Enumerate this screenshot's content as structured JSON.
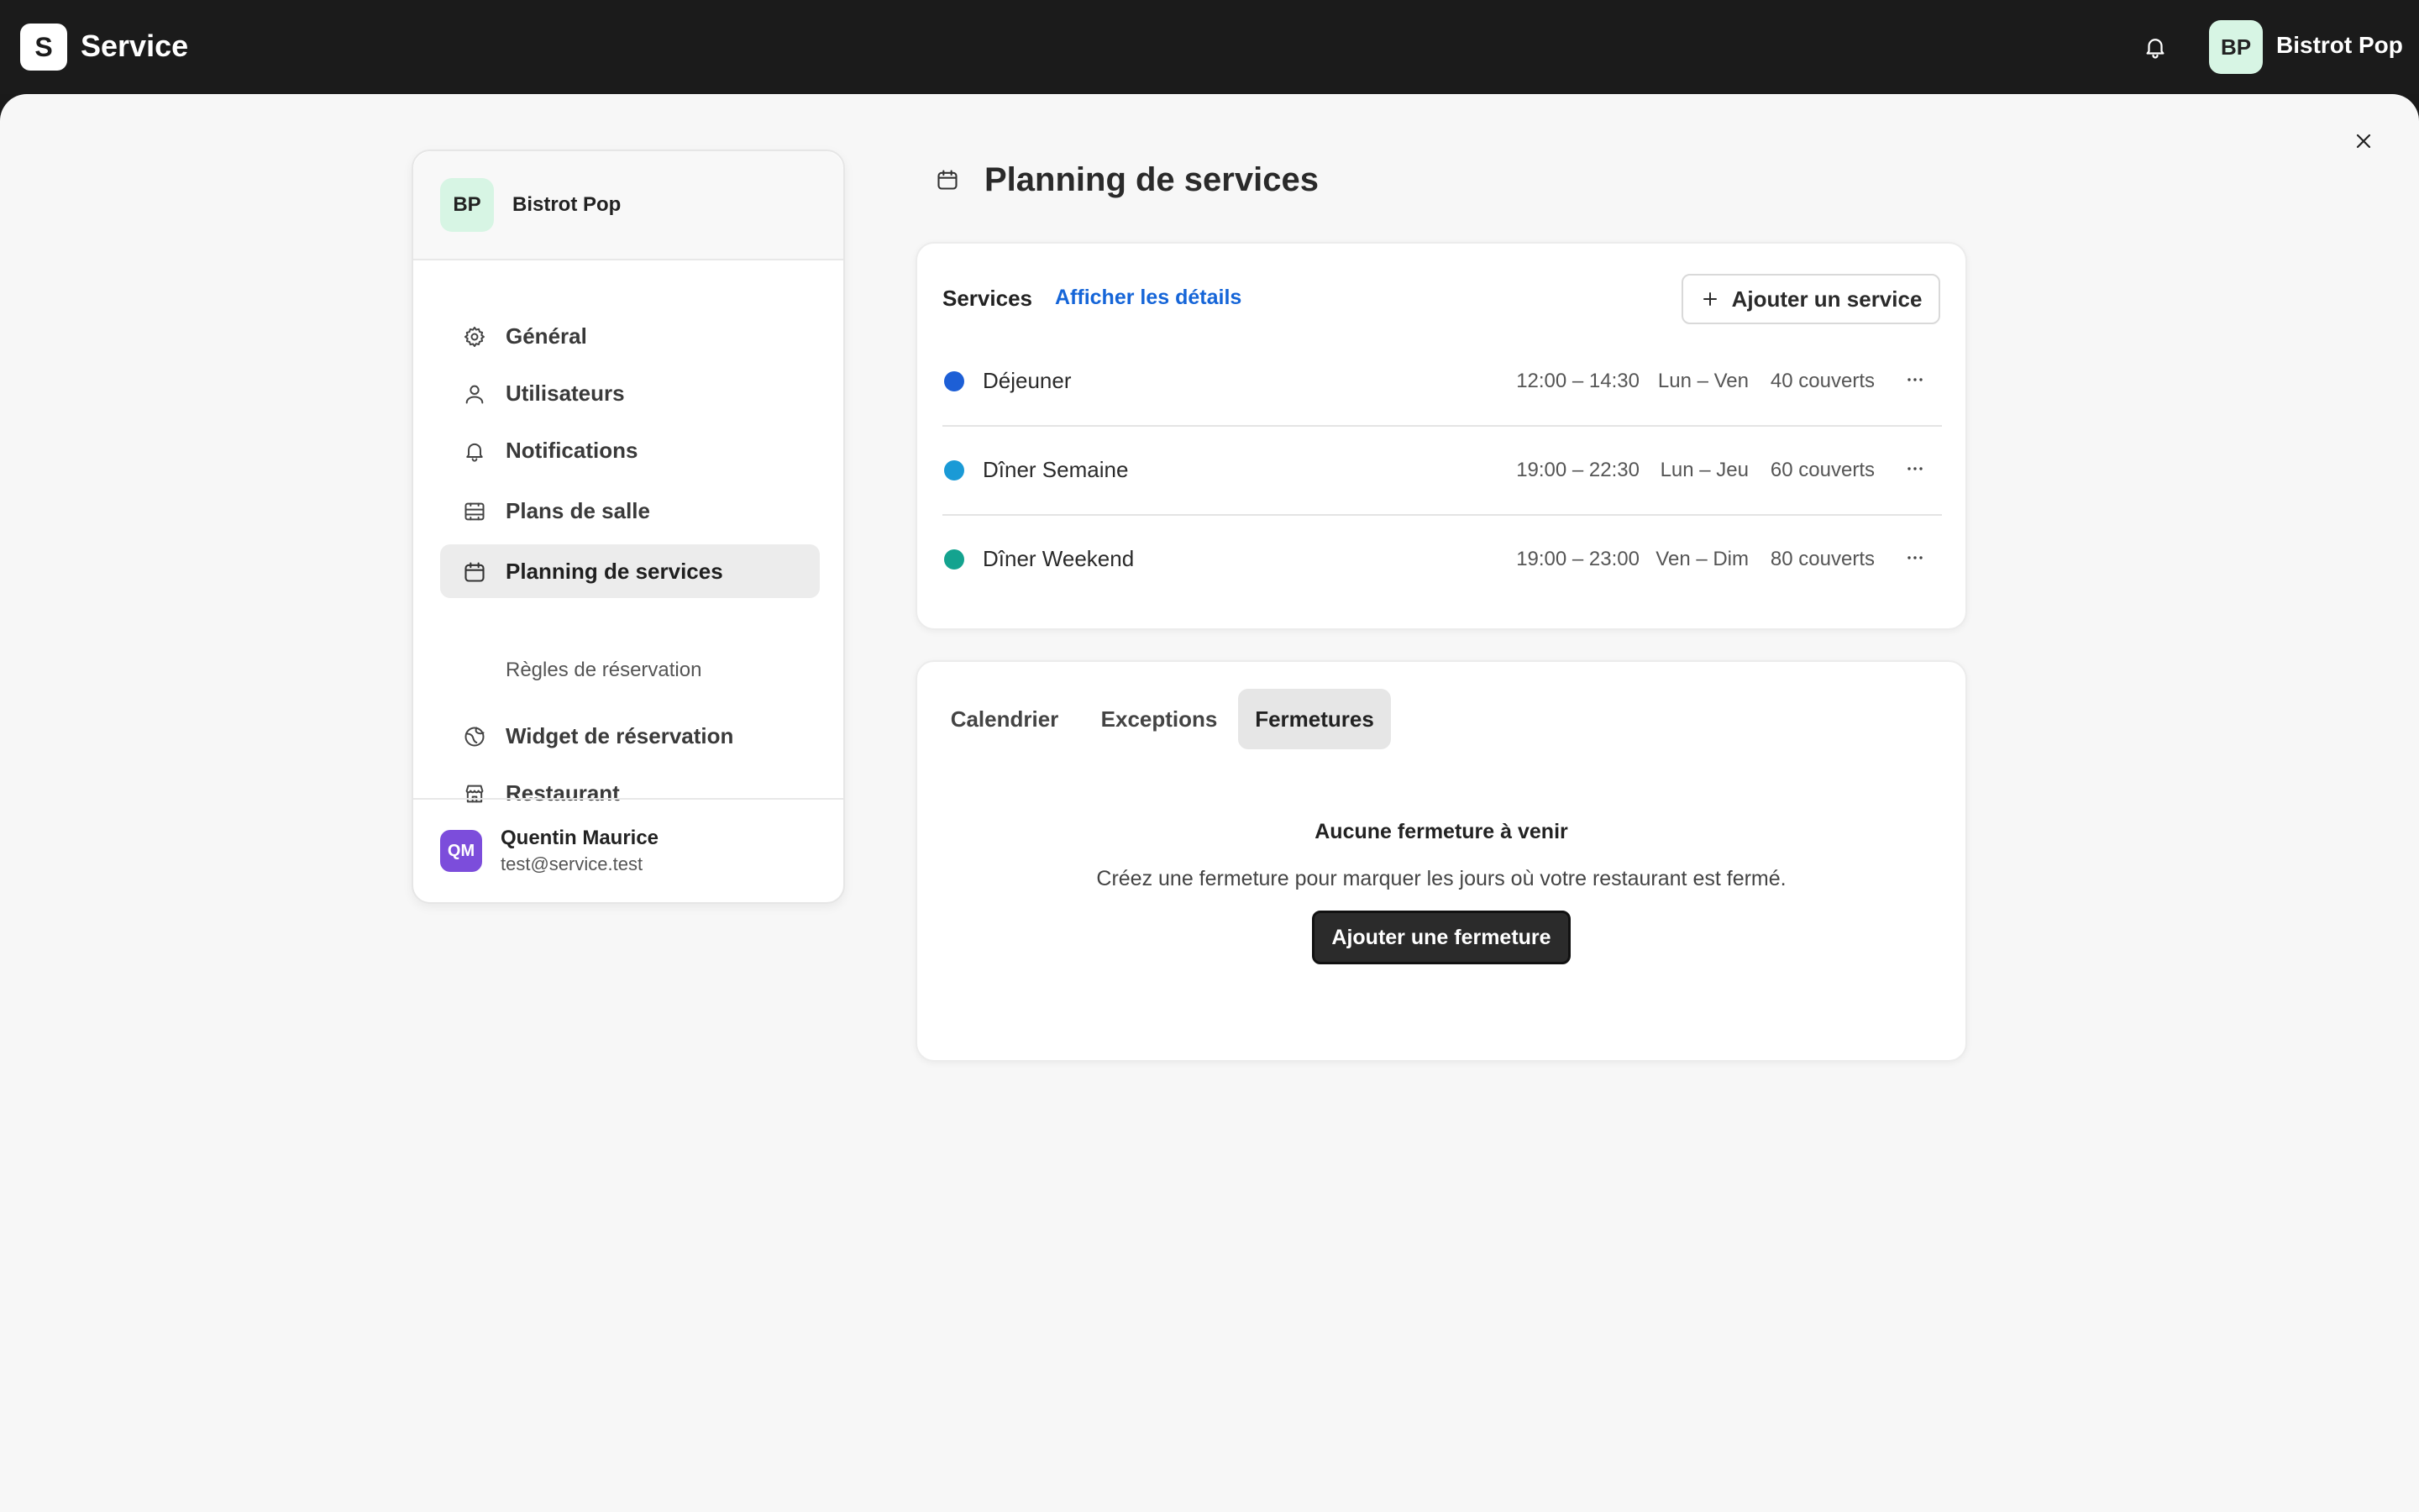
{
  "app": {
    "logo_letter": "S",
    "name": "Service"
  },
  "account": {
    "initials": "BP",
    "name": "Bistrot Pop"
  },
  "sidebar": {
    "org_initials": "BP",
    "org_name": "Bistrot Pop",
    "items": [
      {
        "label": "Général",
        "icon": "gear-icon"
      },
      {
        "label": "Utilisateurs",
        "icon": "user-icon"
      },
      {
        "label": "Notifications",
        "icon": "bell-icon"
      },
      {
        "label": "Plans de salle",
        "icon": "floor-plan-icon"
      },
      {
        "label": "Planning de services",
        "icon": "calendar-icon",
        "active": true
      },
      {
        "label": "Widget de réservation",
        "icon": "globe-icon"
      },
      {
        "label": "Restaurant",
        "icon": "store-icon"
      }
    ],
    "sub_item": "Règles de réservation",
    "user": {
      "initials": "QM",
      "name": "Quentin Maurice",
      "email": "test@service.test"
    }
  },
  "main": {
    "title": "Planning de services",
    "services_card": {
      "title": "Services",
      "details_link": "Afficher les détails",
      "add_button": "Ajouter un service",
      "rows": [
        {
          "name": "Déjeuner",
          "time": "12:00 – 14:30",
          "days": "Lun – Ven",
          "covers": "40 couverts",
          "color": "#1d5fd6"
        },
        {
          "name": "Dîner Semaine",
          "time": "19:00 – 22:30",
          "days": "Lun – Jeu",
          "covers": "60 couverts",
          "color": "#1a9ad6"
        },
        {
          "name": "Dîner Weekend",
          "time": "19:00 – 23:00",
          "days": "Ven – Dim",
          "covers": "80 couverts",
          "color": "#14a38f"
        }
      ]
    },
    "tabs": [
      "Calendrier",
      "Exceptions",
      "Fermetures"
    ],
    "active_tab": "Fermetures",
    "empty_state": {
      "title": "Aucune fermeture à venir",
      "description": "Créez une fermeture pour marquer les jours où votre restaurant est fermé.",
      "button": "Ajouter une fermeture"
    }
  }
}
